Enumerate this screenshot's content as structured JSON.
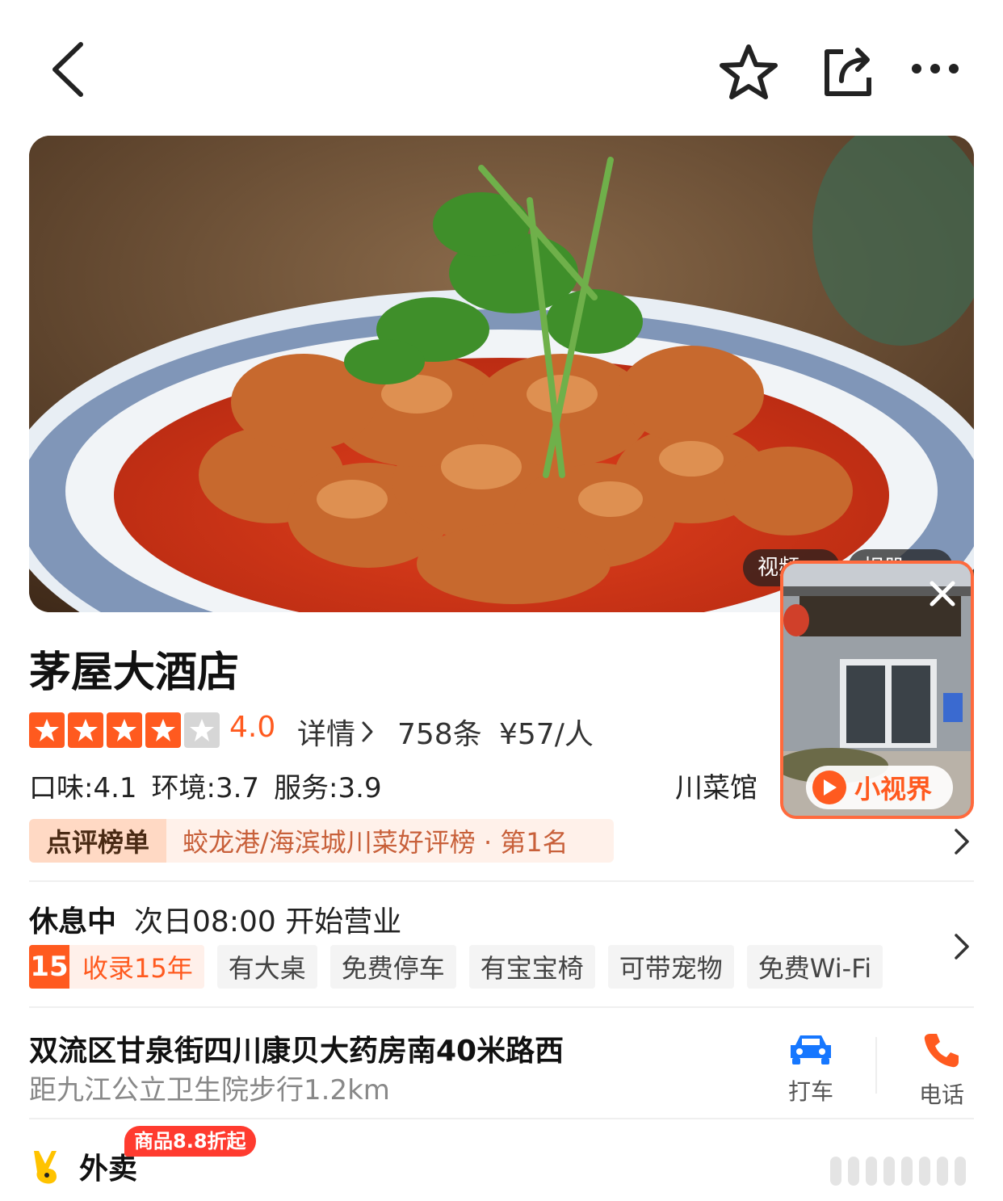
{
  "topbar": {
    "back_icon": "chevron-left-icon",
    "favorite_icon": "star-outline-icon",
    "share_icon": "share-icon",
    "more_icon": "more-dots-icon"
  },
  "hero": {
    "image": "braised-dish-photo",
    "pill_video": "视频 ›",
    "pill_album": "相册 ›"
  },
  "mini_video": {
    "close_icon": "close-icon",
    "badge_text": "小视界"
  },
  "shop": {
    "name": "茅屋大酒店",
    "rating": {
      "stars_filled": 4,
      "stars_total": 5,
      "score": "4.0"
    },
    "detail_link": "详情",
    "review_count": "758条",
    "avg_price": "¥57/人",
    "sub_scores": [
      "口味:4.1",
      "环境:3.7",
      "服务:3.9"
    ],
    "category": "川菜馆",
    "ranking": {
      "label": "点评榜单",
      "text": "蛟龙港/海滨城川菜好评榜 · 第1名"
    }
  },
  "status": {
    "state": "休息中",
    "hours": "次日08:00 开始营业"
  },
  "tags": {
    "years_num": "15",
    "years_label": "收录15年",
    "items": [
      "有大桌",
      "免费停车",
      "有宝宝椅",
      "可带宠物",
      "免费Wi-Fi"
    ]
  },
  "location": {
    "address": "双流区甘泉街四川康贝大药房南40米路西",
    "distance": "距九江公立卫生院步行1.2km"
  },
  "actions": {
    "taxi_label": "打车",
    "phone_label": "电话"
  },
  "waimai": {
    "label": "外卖",
    "promo": "商品8.8折起"
  },
  "colors": {
    "accent": "#ff5a1f",
    "taxi_blue": "#1677ff",
    "promo_red": "#ff3b2f"
  }
}
